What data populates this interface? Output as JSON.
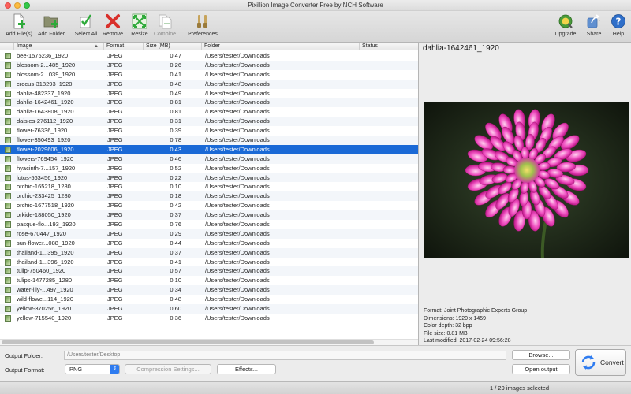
{
  "window": {
    "title": "Pixillion Image Converter Free by NCH Software"
  },
  "toolbar": {
    "add_files": "Add File(s)",
    "add_folder": "Add Folder",
    "select_all": "Select All",
    "remove": "Remove",
    "resize": "Resize",
    "combine": "Combine",
    "preferences": "Preferences",
    "upgrade": "Upgrade",
    "share": "Share",
    "help": "Help"
  },
  "table": {
    "columns": {
      "image": "Image",
      "format": "Format",
      "size": "Size (MB)",
      "folder": "Folder",
      "status": "Status"
    },
    "selected_index": 10,
    "rows": [
      {
        "name": "bee-1575236_1920",
        "format": "JPEG",
        "size": "0.47",
        "folder": "/Users/tester/Downloads"
      },
      {
        "name": "blossom-2...485_1920",
        "format": "JPEG",
        "size": "0.26",
        "folder": "/Users/tester/Downloads"
      },
      {
        "name": "blossom-2...039_1920",
        "format": "JPEG",
        "size": "0.41",
        "folder": "/Users/tester/Downloads"
      },
      {
        "name": "crocus-318293_1920",
        "format": "JPEG",
        "size": "0.48",
        "folder": "/Users/tester/Downloads"
      },
      {
        "name": "dahlia-482337_1920",
        "format": "JPEG",
        "size": "0.49",
        "folder": "/Users/tester/Downloads"
      },
      {
        "name": "dahlia-1642461_1920",
        "format": "JPEG",
        "size": "0.81",
        "folder": "/Users/tester/Downloads"
      },
      {
        "name": "dahlia-1643808_1920",
        "format": "JPEG",
        "size": "0.81",
        "folder": "/Users/tester/Downloads"
      },
      {
        "name": "daisies-276112_1920",
        "format": "JPEG",
        "size": "0.31",
        "folder": "/Users/tester/Downloads"
      },
      {
        "name": "flower-76336_1920",
        "format": "JPEG",
        "size": "0.39",
        "folder": "/Users/tester/Downloads"
      },
      {
        "name": "flower-350493_1920",
        "format": "JPEG",
        "size": "0.78",
        "folder": "/Users/tester/Downloads"
      },
      {
        "name": "flower-2029606_1920",
        "format": "JPEG",
        "size": "0.43",
        "folder": "/Users/tester/Downloads"
      },
      {
        "name": "flowers-769454_1920",
        "format": "JPEG",
        "size": "0.46",
        "folder": "/Users/tester/Downloads"
      },
      {
        "name": "hyacinth-7...157_1920",
        "format": "JPEG",
        "size": "0.52",
        "folder": "/Users/tester/Downloads"
      },
      {
        "name": "lotus-563456_1920",
        "format": "JPEG",
        "size": "0.22",
        "folder": "/Users/tester/Downloads"
      },
      {
        "name": "orchid-165218_1280",
        "format": "JPEG",
        "size": "0.10",
        "folder": "/Users/tester/Downloads"
      },
      {
        "name": "orchid-233425_1280",
        "format": "JPEG",
        "size": "0.18",
        "folder": "/Users/tester/Downloads"
      },
      {
        "name": "orchid-1677518_1920",
        "format": "JPEG",
        "size": "0.42",
        "folder": "/Users/tester/Downloads"
      },
      {
        "name": "orkide-188050_1920",
        "format": "JPEG",
        "size": "0.37",
        "folder": "/Users/tester/Downloads"
      },
      {
        "name": "pasque-flo...193_1920",
        "format": "JPEG",
        "size": "0.76",
        "folder": "/Users/tester/Downloads"
      },
      {
        "name": "rose-670447_1920",
        "format": "JPEG",
        "size": "0.29",
        "folder": "/Users/tester/Downloads"
      },
      {
        "name": "sun-flower...088_1920",
        "format": "JPEG",
        "size": "0.44",
        "folder": "/Users/tester/Downloads"
      },
      {
        "name": "thailand-1...395_1920",
        "format": "JPEG",
        "size": "0.37",
        "folder": "/Users/tester/Downloads"
      },
      {
        "name": "thailand-1...396_1920",
        "format": "JPEG",
        "size": "0.41",
        "folder": "/Users/tester/Downloads"
      },
      {
        "name": "tulip-750460_1920",
        "format": "JPEG",
        "size": "0.57",
        "folder": "/Users/tester/Downloads"
      },
      {
        "name": "tulips-1477285_1280",
        "format": "JPEG",
        "size": "0.10",
        "folder": "/Users/tester/Downloads"
      },
      {
        "name": "water-lily-...497_1920",
        "format": "JPEG",
        "size": "0.34",
        "folder": "/Users/tester/Downloads"
      },
      {
        "name": "wild-flowe...114_1920",
        "format": "JPEG",
        "size": "0.48",
        "folder": "/Users/tester/Downloads"
      },
      {
        "name": "yellow-370256_1920",
        "format": "JPEG",
        "size": "0.60",
        "folder": "/Users/tester/Downloads"
      },
      {
        "name": "yellow-715540_1920",
        "format": "JPEG",
        "size": "0.36",
        "folder": "/Users/tester/Downloads"
      }
    ]
  },
  "preview": {
    "title": "dahlia-1642461_1920",
    "format": "Format: Joint Photographic Experts Group",
    "dimensions": "Dimensions: 1920 x 1459",
    "color_depth": "Color depth: 32 bpp",
    "file_size": "File size: 0.81 MB",
    "last_modified": "Last modified: 2017-02-24 09:56:28"
  },
  "output": {
    "folder_label": "Output Folder:",
    "folder_value": "/Users/tester/Desktop",
    "browse": "Browse...",
    "format_label": "Output Format:",
    "format_value": "PNG",
    "compression": "Compression Settings...",
    "effects": "Effects...",
    "open_output": "Open output",
    "convert": "Convert"
  },
  "status": {
    "text": "1 / 29 images selected"
  },
  "colors": {
    "selection": "#1a69d6",
    "accent": "#2f7cf0",
    "remove_red": "#d9302b",
    "flower_pink": "#e33bb0"
  }
}
